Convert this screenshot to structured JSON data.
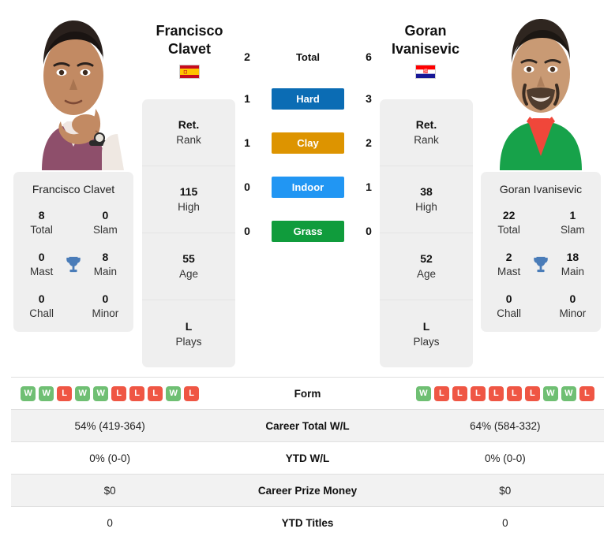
{
  "players": {
    "left": {
      "name_line1": "Francisco",
      "name_line2": "Clavet",
      "full_name": "Francisco Clavet",
      "country": "Spain",
      "flag_icon": "flag-spain",
      "titles": {
        "total_value": "8",
        "total_label": "Total",
        "slam_value": "0",
        "slam_label": "Slam",
        "mast_value": "0",
        "mast_label": "Mast",
        "main_value": "8",
        "main_label": "Main",
        "chall_value": "0",
        "chall_label": "Chall",
        "minor_value": "0",
        "minor_label": "Minor"
      },
      "ranks": [
        {
          "value": "Ret.",
          "label": "Rank"
        },
        {
          "value": "115",
          "label": "High"
        },
        {
          "value": "55",
          "label": "Age"
        },
        {
          "value": "L",
          "label": "Plays"
        }
      ],
      "form": [
        "W",
        "W",
        "L",
        "W",
        "W",
        "L",
        "L",
        "L",
        "W",
        "L"
      ],
      "career_total_wl": "54% (419-364)",
      "ytd_wl": "0% (0-0)",
      "career_prize_money": "$0",
      "ytd_titles": "0"
    },
    "right": {
      "name_line1": "Goran",
      "name_line2": "Ivanisevic",
      "full_name": "Goran Ivanisevic",
      "country": "Croatia",
      "flag_icon": "flag-croatia",
      "titles": {
        "total_value": "22",
        "total_label": "Total",
        "slam_value": "1",
        "slam_label": "Slam",
        "mast_value": "2",
        "mast_label": "Mast",
        "main_value": "18",
        "main_label": "Main",
        "chall_value": "0",
        "chall_label": "Chall",
        "minor_value": "0",
        "minor_label": "Minor"
      },
      "ranks": [
        {
          "value": "Ret.",
          "label": "Rank"
        },
        {
          "value": "38",
          "label": "High"
        },
        {
          "value": "52",
          "label": "Age"
        },
        {
          "value": "L",
          "label": "Plays"
        }
      ],
      "form": [
        "W",
        "L",
        "L",
        "L",
        "L",
        "L",
        "L",
        "W",
        "W",
        "L"
      ],
      "career_total_wl": "64% (584-332)",
      "ytd_wl": "0% (0-0)",
      "career_prize_money": "$0",
      "ytd_titles": "0"
    }
  },
  "head_to_head": {
    "rows": [
      {
        "label": "Total",
        "left": "2",
        "right": "6",
        "color": "none"
      },
      {
        "label": "Hard",
        "left": "1",
        "right": "3",
        "color": "#0b6cb4"
      },
      {
        "label": "Clay",
        "left": "1",
        "right": "2",
        "color": "#dd9400"
      },
      {
        "label": "Indoor",
        "left": "0",
        "right": "1",
        "color": "#2196f3"
      },
      {
        "label": "Grass",
        "left": "0",
        "right": "0",
        "color": "#109c3c"
      }
    ]
  },
  "table_rows": [
    {
      "label": "Form",
      "type": "form"
    },
    {
      "label": "Career Total W/L",
      "type": "text",
      "key": "career_total_wl"
    },
    {
      "label": "YTD W/L",
      "type": "text",
      "key": "ytd_wl"
    },
    {
      "label": "Career Prize Money",
      "type": "text",
      "key": "career_prize_money"
    },
    {
      "label": "YTD Titles",
      "type": "text",
      "key": "ytd_titles"
    }
  ],
  "icons": {
    "trophy": "trophy-icon"
  },
  "colors": {
    "win": "#6fbf73",
    "loss": "#ef5644",
    "card_bg": "#efefef",
    "row_alt": "#f2f2f2"
  }
}
